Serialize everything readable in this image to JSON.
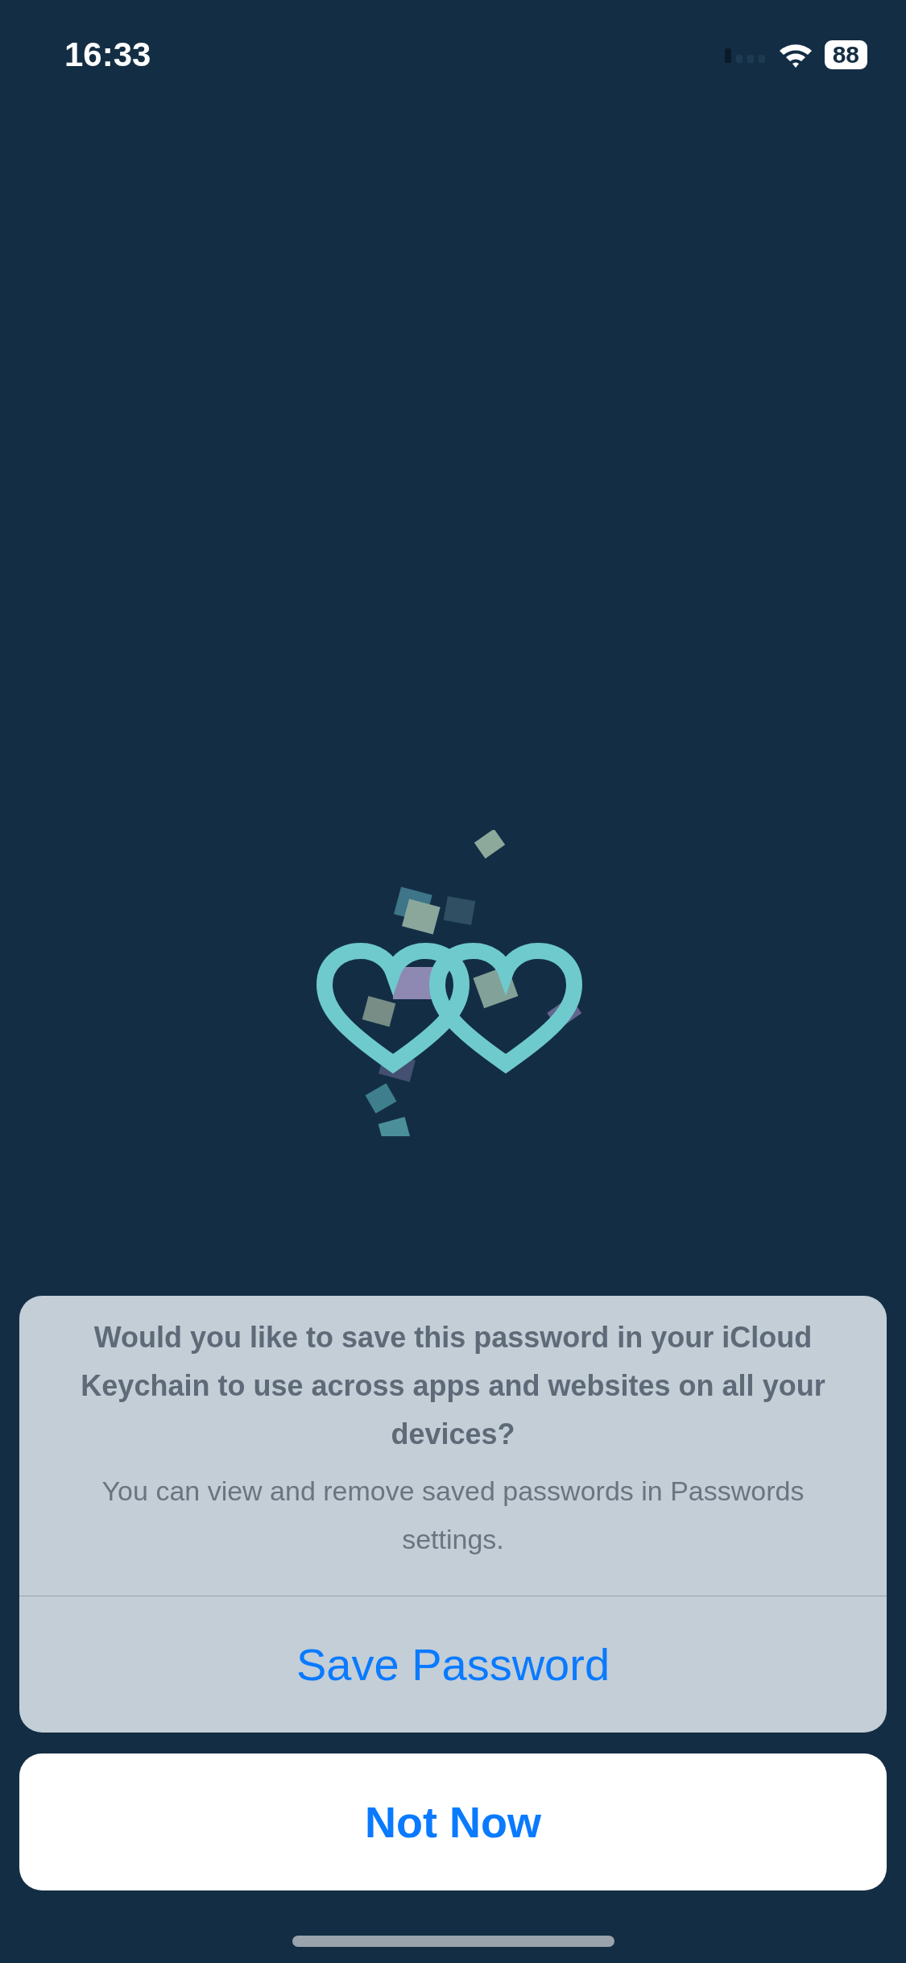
{
  "status_bar": {
    "time": "16:33",
    "battery": "88"
  },
  "alert": {
    "title": "Would you like to save this password in your iCloud Keychain to use across apps and websites on all your devices?",
    "message": "You can view and remove saved passwords in Passwords settings.",
    "actions": [
      {
        "label": "Save Password",
        "kind": "default"
      }
    ]
  },
  "cancel_button": {
    "label": "Not Now"
  }
}
